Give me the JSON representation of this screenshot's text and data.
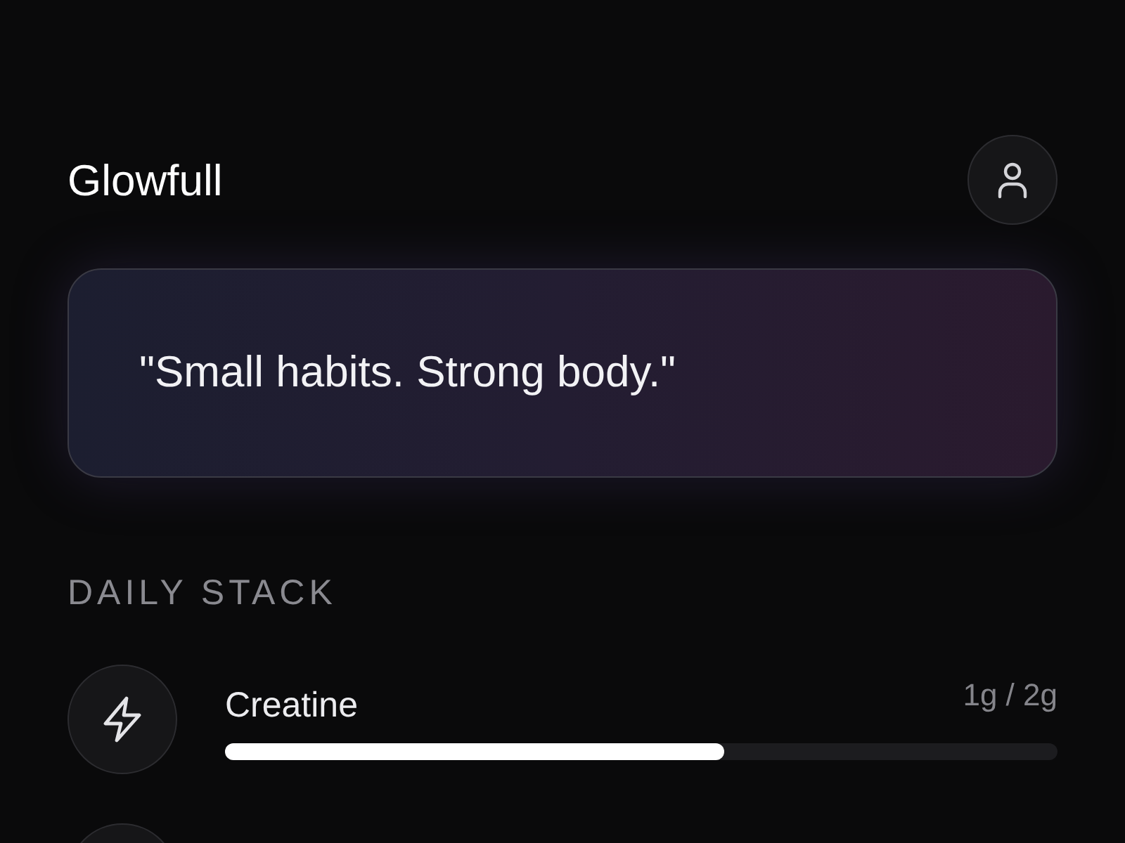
{
  "app": {
    "title": "Glowfull"
  },
  "quote": "\"Small habits. Strong body.\"",
  "section_title": "DAILY STACK",
  "stack": [
    {
      "kind": "bolt",
      "name": "Creatine",
      "reading": "1g / 2g",
      "level": 0.6
    }
  ]
}
